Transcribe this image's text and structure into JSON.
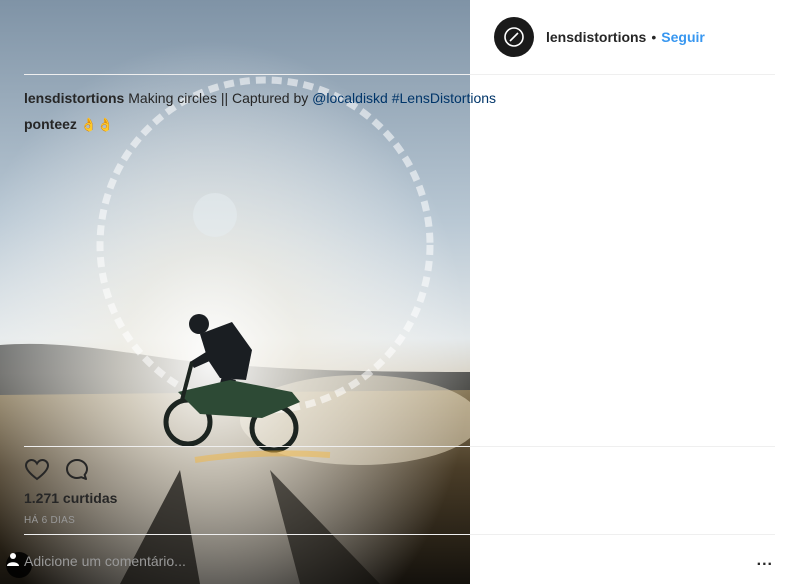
{
  "post": {
    "username": "lensdistortions",
    "separator": "•",
    "follow_label": "Seguir",
    "caption": {
      "username": "lensdistortions",
      "text": "Making circles || Captured by",
      "mention": "@localdiskd",
      "hashtag": "#LensDistortions"
    },
    "comments": [
      {
        "username": "ponteez",
        "text": "👌👌"
      }
    ],
    "likes_text": "1.271 curtidas",
    "time_text": "HÁ 6 DIAS",
    "comment_placeholder": "Adicione um comentário...",
    "more_label": "..."
  },
  "icons": {
    "like": "heart-outline-icon",
    "comment": "speech-bubble-icon",
    "user_tag": "person-icon",
    "avatar": "lens-logo-icon"
  },
  "colors": {
    "link": "#003569",
    "follow": "#3897f0",
    "muted": "#999999",
    "text": "#262626"
  }
}
